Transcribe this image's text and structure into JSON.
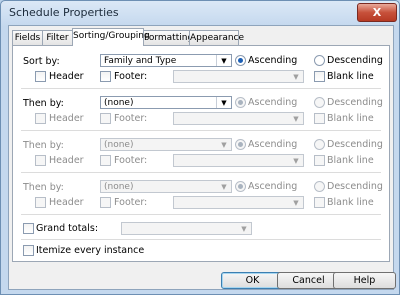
{
  "window": {
    "title": "Schedule Properties",
    "close_label": "X"
  },
  "tabs": [
    "Fields",
    "Filter",
    "Sorting/Grouping",
    "Formatting",
    "Appearance"
  ],
  "groups": [
    {
      "label": "Sort by:",
      "value": "Family and Type",
      "ascending": "Ascending",
      "descending": "Descending",
      "header": "Header",
      "footer": "Footer:",
      "blank": "Blank line"
    },
    {
      "label": "Then by:",
      "value": "(none)",
      "ascending": "Ascending",
      "descending": "Descending",
      "header": "Header",
      "footer": "Footer:",
      "blank": "Blank line"
    },
    {
      "label": "Then by:",
      "value": "(none)",
      "ascending": "Ascending",
      "descending": "Descending",
      "header": "Header",
      "footer": "Footer:",
      "blank": "Blank line"
    },
    {
      "label": "Then by:",
      "value": "(none)",
      "ascending": "Ascending",
      "descending": "Descending",
      "header": "Header",
      "footer": "Footer:",
      "blank": "Blank line"
    }
  ],
  "grand_totals": {
    "label": "Grand totals:"
  },
  "itemize": {
    "label": "Itemize every instance"
  },
  "buttons": {
    "ok": "OK",
    "cancel": "Cancel",
    "help": "Help"
  },
  "icons": {
    "dropdown": "chevron-down-icon",
    "close": "close-icon"
  }
}
